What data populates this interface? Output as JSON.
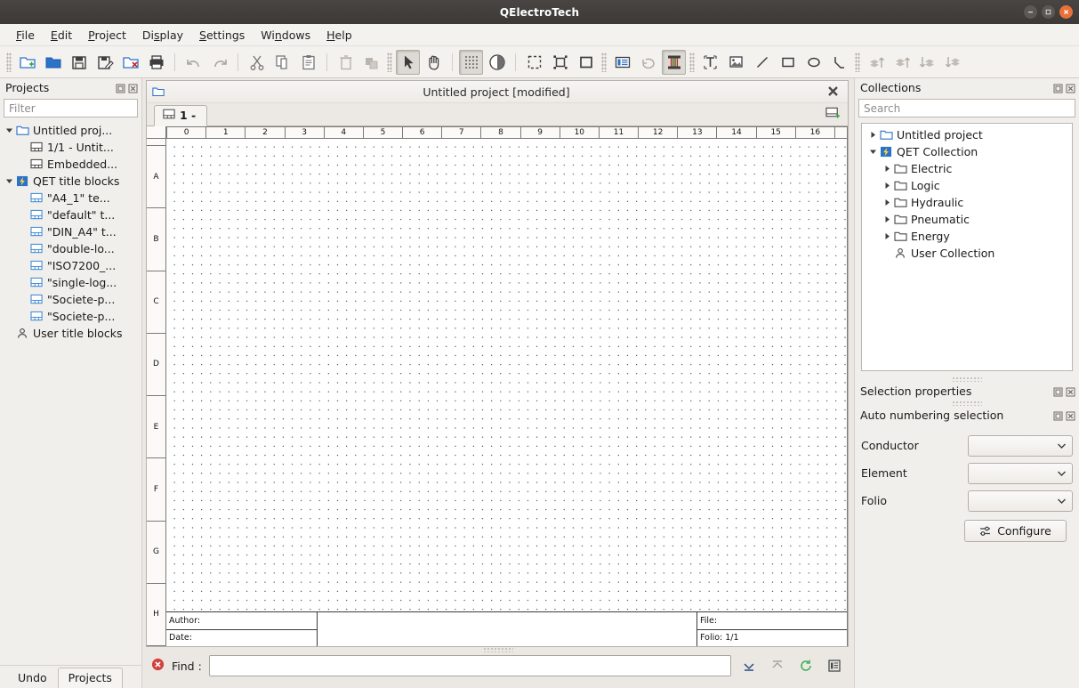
{
  "window": {
    "title": "QElectroTech",
    "controls": {
      "minimize": "–",
      "maximize": "□",
      "close": "x"
    }
  },
  "menubar": {
    "items": [
      {
        "label": "File"
      },
      {
        "label": "Edit"
      },
      {
        "label": "Project"
      },
      {
        "label": "Display"
      },
      {
        "label": "Settings"
      },
      {
        "label": "Windows"
      },
      {
        "label": "Help"
      }
    ]
  },
  "toolbar": {
    "groups": [
      {
        "buttons": [
          {
            "name": "new-project-icon",
            "active": false
          },
          {
            "name": "open-project-icon",
            "active": false
          },
          {
            "name": "save-icon",
            "active": false
          },
          {
            "name": "save-as-icon",
            "active": false
          },
          {
            "name": "close-project-icon",
            "active": false
          },
          {
            "name": "print-icon",
            "active": false
          }
        ]
      },
      {
        "buttons": [
          {
            "name": "undo-icon",
            "active": false
          },
          {
            "name": "redo-icon",
            "active": false
          }
        ]
      },
      {
        "buttons": [
          {
            "name": "cut-icon",
            "active": false
          },
          {
            "name": "copy-icon",
            "active": false
          },
          {
            "name": "paste-icon",
            "active": false
          }
        ]
      },
      {
        "buttons": [
          {
            "name": "delete-icon",
            "active": false
          },
          {
            "name": "duplicate-icon",
            "active": false
          }
        ]
      },
      {
        "buttons": [
          {
            "name": "select-tool-icon",
            "active": true
          },
          {
            "name": "pan-tool-icon",
            "active": false
          }
        ]
      },
      {
        "buttons": [
          {
            "name": "toggle-grid-icon",
            "active": true
          },
          {
            "name": "toggle-contrast-icon",
            "active": false
          }
        ]
      },
      {
        "buttons": [
          {
            "name": "select-all-icon",
            "active": false
          },
          {
            "name": "select-invert-icon",
            "active": false
          },
          {
            "name": "select-none-icon",
            "active": false
          }
        ]
      },
      {
        "buttons": [
          {
            "name": "folio-properties-icon",
            "active": false
          },
          {
            "name": "rotate-icon",
            "active": false
          },
          {
            "name": "conductor-reset-icon",
            "active": true
          }
        ]
      },
      {
        "buttons": [
          {
            "name": "add-text-icon",
            "active": false
          },
          {
            "name": "add-image-icon",
            "active": false
          },
          {
            "name": "draw-line-icon",
            "active": false
          },
          {
            "name": "draw-rectangle-icon",
            "active": false
          },
          {
            "name": "draw-ellipse-icon",
            "active": false
          },
          {
            "name": "draw-polyline-icon",
            "active": false
          }
        ]
      },
      {
        "buttons": [
          {
            "name": "raise-icon",
            "active": false
          },
          {
            "name": "bring-forward-icon",
            "active": false
          },
          {
            "name": "send-backward-icon",
            "active": false
          },
          {
            "name": "lower-icon",
            "active": false
          }
        ]
      }
    ]
  },
  "projects_panel": {
    "title": "Projects",
    "filter_placeholder": "Filter",
    "tree": [
      {
        "label": "Untitled proj...",
        "icon": "project-folder-icon",
        "indent": 0,
        "expander": "down"
      },
      {
        "label": "1/1 - Untit...",
        "icon": "folio-icon",
        "indent": 1,
        "expander": "none"
      },
      {
        "label": "Embedded...",
        "icon": "folio-icon",
        "indent": 1,
        "expander": "none"
      },
      {
        "label": "QET title blocks",
        "icon": "qet-collection-icon",
        "indent": 0,
        "expander": "down"
      },
      {
        "label": "\"A4_1\" te...",
        "icon": "titleblock-icon",
        "indent": 1,
        "expander": "none"
      },
      {
        "label": "\"default\" t...",
        "icon": "titleblock-icon",
        "indent": 1,
        "expander": "none"
      },
      {
        "label": "\"DIN_A4\" t...",
        "icon": "titleblock-icon",
        "indent": 1,
        "expander": "none"
      },
      {
        "label": "\"double-lo...",
        "icon": "titleblock-icon",
        "indent": 1,
        "expander": "none"
      },
      {
        "label": "\"ISO7200_...",
        "icon": "titleblock-icon",
        "indent": 1,
        "expander": "none"
      },
      {
        "label": "\"single-log...",
        "icon": "titleblock-icon",
        "indent": 1,
        "expander": "none"
      },
      {
        "label": "\"Societe-p...",
        "icon": "titleblock-icon",
        "indent": 1,
        "expander": "none"
      },
      {
        "label": "\"Societe-p...",
        "icon": "titleblock-icon",
        "indent": 1,
        "expander": "none"
      },
      {
        "label": "User title blocks",
        "icon": "user-icon",
        "indent": 0,
        "expander": "none"
      }
    ],
    "tabs": [
      {
        "label": "Undo",
        "active": false
      },
      {
        "label": "Projects",
        "active": true
      }
    ]
  },
  "document": {
    "mdi_title": "Untitled project [modified]",
    "tab_label": "1 -",
    "ruler_h": [
      "0",
      "1",
      "2",
      "3",
      "4",
      "5",
      "6",
      "7",
      "8",
      "9",
      "10",
      "11",
      "12",
      "13",
      "14",
      "15",
      "16"
    ],
    "ruler_v": [
      "A",
      "B",
      "C",
      "D",
      "E",
      "F",
      "G",
      "H"
    ],
    "titleblock": {
      "author_label": "Author:",
      "date_label": "Date:",
      "file_label": "File:",
      "folio_label": "Folio: 1/1"
    }
  },
  "findbar": {
    "label": "Find :",
    "value": "",
    "placeholder": "",
    "buttons": [
      {
        "name": "find-next-icon"
      },
      {
        "name": "find-previous-icon"
      },
      {
        "name": "find-refresh-icon"
      },
      {
        "name": "find-list-icon"
      }
    ]
  },
  "collections_panel": {
    "title": "Collections",
    "search_placeholder": "Search",
    "tree": [
      {
        "label": "Untitled project",
        "icon": "project-folder-icon",
        "indent": 0,
        "expander": "right"
      },
      {
        "label": "QET Collection",
        "icon": "qet-collection-icon",
        "indent": 0,
        "expander": "down"
      },
      {
        "label": "Electric",
        "icon": "folder-icon",
        "indent": 1,
        "expander": "right"
      },
      {
        "label": "Logic",
        "icon": "folder-icon",
        "indent": 1,
        "expander": "right"
      },
      {
        "label": "Hydraulic",
        "icon": "folder-icon",
        "indent": 1,
        "expander": "right"
      },
      {
        "label": "Pneumatic",
        "icon": "folder-icon",
        "indent": 1,
        "expander": "right"
      },
      {
        "label": "Energy",
        "icon": "folder-icon",
        "indent": 1,
        "expander": "right"
      },
      {
        "label": "User Collection",
        "icon": "user-icon",
        "indent": 1,
        "expander": "none"
      }
    ]
  },
  "selection_panel": {
    "title": "Selection properties"
  },
  "autonumber_panel": {
    "title": "Auto numbering selection",
    "rows": [
      {
        "label": "Conductor",
        "value": ""
      },
      {
        "label": "Element",
        "value": ""
      },
      {
        "label": "Folio",
        "value": ""
      }
    ],
    "configure_label": "Configure"
  },
  "colors": {
    "accent_blue": "#3a7fd5",
    "close_orange": "#e8703a",
    "titlebar": "#3c3936",
    "panel_bg": "#f1efec",
    "canvas": "#ffffff"
  }
}
